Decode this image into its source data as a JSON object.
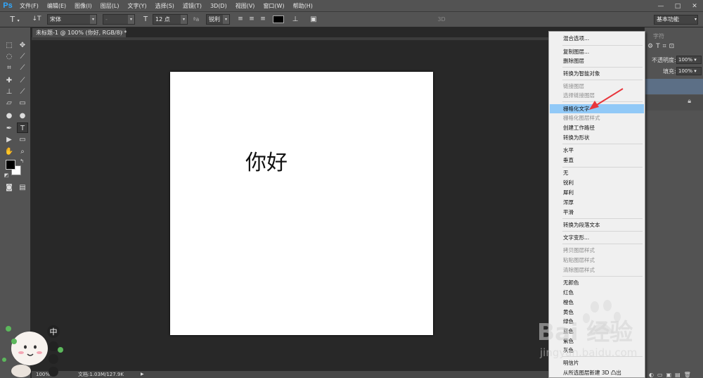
{
  "app": {
    "logo": "Ps"
  },
  "menubar": {
    "items": [
      "文件(F)",
      "编辑(E)",
      "图像(I)",
      "图层(L)",
      "文字(Y)",
      "选择(S)",
      "滤镜(T)",
      "3D(D)",
      "视图(V)",
      "窗口(W)",
      "帮助(H)"
    ],
    "window_controls": [
      "—",
      "□",
      "✕"
    ]
  },
  "options": {
    "font_family": "宋体",
    "font_style": "-",
    "font_size": "12 点",
    "aa_label": "ªa",
    "antialias": "锐利",
    "mode_3d": "3D",
    "workspace": "基本功能"
  },
  "document": {
    "tab_title": "未标题-1 @ 100% (你好, RGB/8) *",
    "tab_close": "×",
    "canvas_text": "你好",
    "status_zoom": "100%",
    "status_doc": "文档:1.03M/127.9K"
  },
  "layers_panel": {
    "tab_label": "字符",
    "opacity_label": "不透明度:",
    "opacity_value": "100%",
    "fill_label": "填充:",
    "fill_value": "100%"
  },
  "context_menu": {
    "items": [
      {
        "label": "混合选项...",
        "disabled": false
      },
      {
        "label": "复制图层...",
        "disabled": false
      },
      {
        "label": "删除图层",
        "disabled": false
      },
      {
        "label": "转换为智能对象",
        "disabled": false
      },
      {
        "label": "链接图层",
        "disabled": true
      },
      {
        "label": "选择链接图层",
        "disabled": true
      },
      {
        "label": "栅格化文字",
        "disabled": false,
        "highlighted": true
      },
      {
        "label": "栅格化图层样式",
        "disabled": true
      },
      {
        "label": "创建工作路径",
        "disabled": false
      },
      {
        "label": "转换为形状",
        "disabled": false
      },
      {
        "label": "水平",
        "disabled": false
      },
      {
        "label": "垂直",
        "disabled": false
      },
      {
        "label": "无",
        "disabled": false
      },
      {
        "label": "锐利",
        "disabled": false
      },
      {
        "label": "犀利",
        "disabled": false
      },
      {
        "label": "浑厚",
        "disabled": false
      },
      {
        "label": "平滑",
        "disabled": false
      },
      {
        "label": "转换为段落文本",
        "disabled": false
      },
      {
        "label": "文字变形...",
        "disabled": false
      },
      {
        "label": "拷贝图层样式",
        "disabled": true
      },
      {
        "label": "粘贴图层样式",
        "disabled": true
      },
      {
        "label": "清除图层样式",
        "disabled": true
      },
      {
        "label": "无颜色",
        "disabled": false
      },
      {
        "label": "红色",
        "disabled": false
      },
      {
        "label": "橙色",
        "disabled": false
      },
      {
        "label": "黄色",
        "disabled": false
      },
      {
        "label": "绿色",
        "disabled": false
      },
      {
        "label": "蓝色",
        "disabled": false
      },
      {
        "label": "紫色",
        "disabled": false
      },
      {
        "label": "灰色",
        "disabled": false
      },
      {
        "label": "明信片",
        "disabled": false
      },
      {
        "label": "从所选图层新建 3D 凸出",
        "disabled": false
      }
    ]
  },
  "watermark": {
    "main": "Bai 经验",
    "url": "jingyan.baidu.com"
  },
  "sticker": {
    "badge": "中"
  },
  "colors": {
    "highlight": "#91c9f7",
    "arrow": "#e8353b",
    "layer_selected": "#5c6f86"
  }
}
